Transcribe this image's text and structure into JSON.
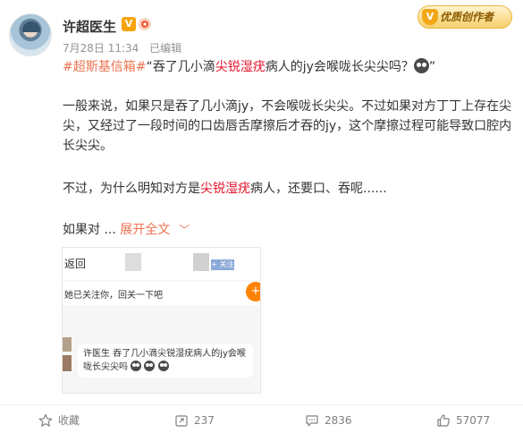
{
  "author": {
    "name": "许超医生",
    "verified_badge": "V"
  },
  "meta": {
    "timestamp": "7月28日 11:34",
    "edited": "已编辑"
  },
  "creator_badge": {
    "label": "优质创作者",
    "icon": "V"
  },
  "post": {
    "p1_tag": "#超斯基信箱#",
    "p1_a": "“吞了几小滴",
    "p1_red": "尖锐湿疣",
    "p1_b": "病人的jy会喉咙长尖尖吗？",
    "p1_c": "”",
    "p2": "一般来说，如果只是吞了几小滴jy，不会喉咙长尖尖。不过如果对方丁丁上存在尖尖，又经过了一段时间的口齿唇舌摩擦后才吞的jy，这个摩擦过程可能导致口腔内长尖尖。",
    "p3_a": "不过，为什么明知对方是",
    "p3_red": "尖锐湿疣",
    "p3_b": "病人，还要口、吞呢......",
    "p4_a": "如果对 ... ",
    "p4_expand": "展开全文"
  },
  "screenshot": {
    "row1_text": "返回",
    "follow_label": "+ 关注",
    "row2_text": "她已关注你，回关一下吧",
    "plus": "+",
    "bubble_text": "许医生 吞了几小滴尖锐湿疣病人的jy会喉咙长尖尖吗"
  },
  "actions": {
    "favorite": "收藏",
    "repost": "237",
    "comment": "2836",
    "like": "57077"
  }
}
